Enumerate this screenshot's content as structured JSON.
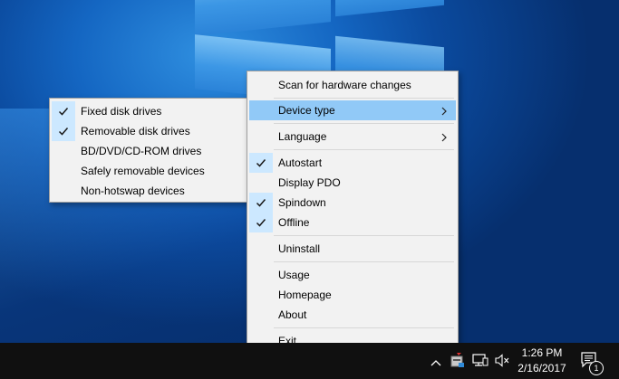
{
  "colors": {
    "desktop_accent": "#1466c2",
    "menu_background": "#f2f2f2",
    "highlight": "#91c9f7",
    "check_background": "#cce8ff",
    "taskbar": "#101010"
  },
  "main_menu": {
    "items": [
      {
        "label": "Scan for hardware changes"
      },
      {
        "label": "Device type",
        "submenu": true,
        "highlighted": true
      },
      {
        "label": "Language",
        "submenu": true
      },
      {
        "label": "Autostart",
        "checked": true
      },
      {
        "label": "Display PDO",
        "checked": false
      },
      {
        "label": "Spindown",
        "checked": true
      },
      {
        "label": "Offline",
        "checked": true
      },
      {
        "label": "Uninstall"
      },
      {
        "label": "Usage"
      },
      {
        "label": "Homepage"
      },
      {
        "label": "About"
      },
      {
        "label": "Exit"
      }
    ]
  },
  "device_type_submenu": {
    "items": [
      {
        "label": "Fixed disk drives",
        "checked": true
      },
      {
        "label": "Removable disk drives",
        "checked": true
      },
      {
        "label": "BD/DVD/CD-ROM drives",
        "checked": false
      },
      {
        "label": "Safely removable devices",
        "checked": false
      },
      {
        "label": "Non-hotswap devices",
        "checked": false
      }
    ]
  },
  "taskbar": {
    "time": "1:26 PM",
    "date": "2/16/2017",
    "notification_count": "1",
    "icons": [
      "chevron-up-icon",
      "drive-app-icon",
      "network-icon",
      "volume-muted-icon",
      "action-center-icon"
    ]
  }
}
